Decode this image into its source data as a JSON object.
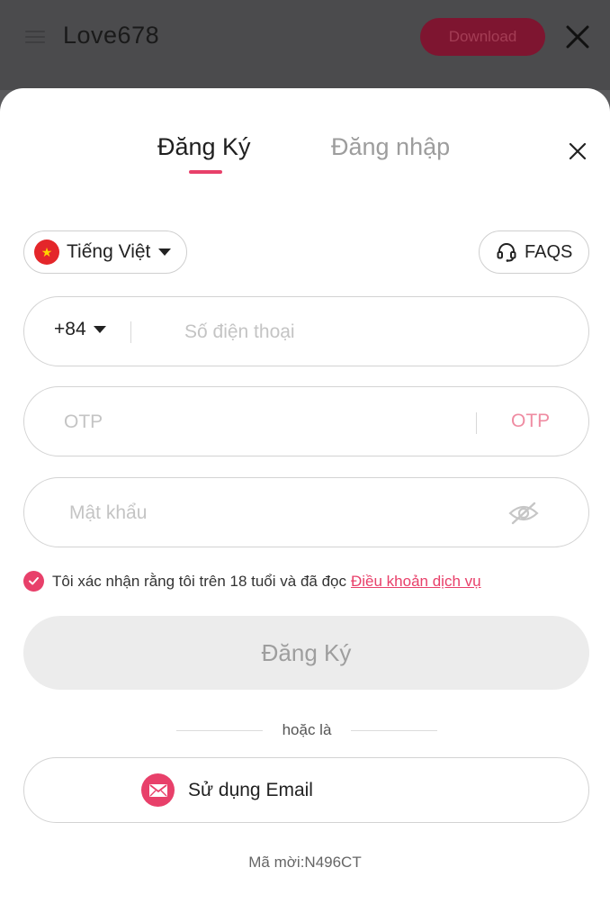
{
  "topbar": {
    "app_title": "Love678",
    "download_label": "Download"
  },
  "tabs": [
    {
      "label": "Đăng Ký",
      "active": true
    },
    {
      "label": "Đăng nhập",
      "active": false
    }
  ],
  "language": {
    "label": "Tiếng Việt",
    "flag_icon": "vietnam-flag-icon"
  },
  "faq": {
    "label": "FAQS",
    "icon": "headset-icon"
  },
  "phone": {
    "country_code": "+84",
    "placeholder": "Số điện thoại",
    "value": ""
  },
  "otp": {
    "placeholder": "OTP",
    "value": "",
    "send_label": "OTP"
  },
  "password": {
    "placeholder": "Mật khẩu",
    "value": "",
    "icon": "eye-off-icon"
  },
  "consent": {
    "checked": true,
    "text": "Tôi xác nhận rằng tôi trên 18 tuổi và đã đọc",
    "link_text": "Điều khoản dịch vụ"
  },
  "submit_label": "Đăng Ký",
  "divider_text": "hoặc là",
  "email_option": {
    "label": "Sử dụng Email",
    "icon": "mail-icon"
  },
  "invite_code": "Mã mời:N496CT",
  "colors": {
    "accent": "#e8406a",
    "accent_light": "#ef8ca2",
    "disabled_bg": "#ececec",
    "overlay": "#5a5a5c"
  }
}
